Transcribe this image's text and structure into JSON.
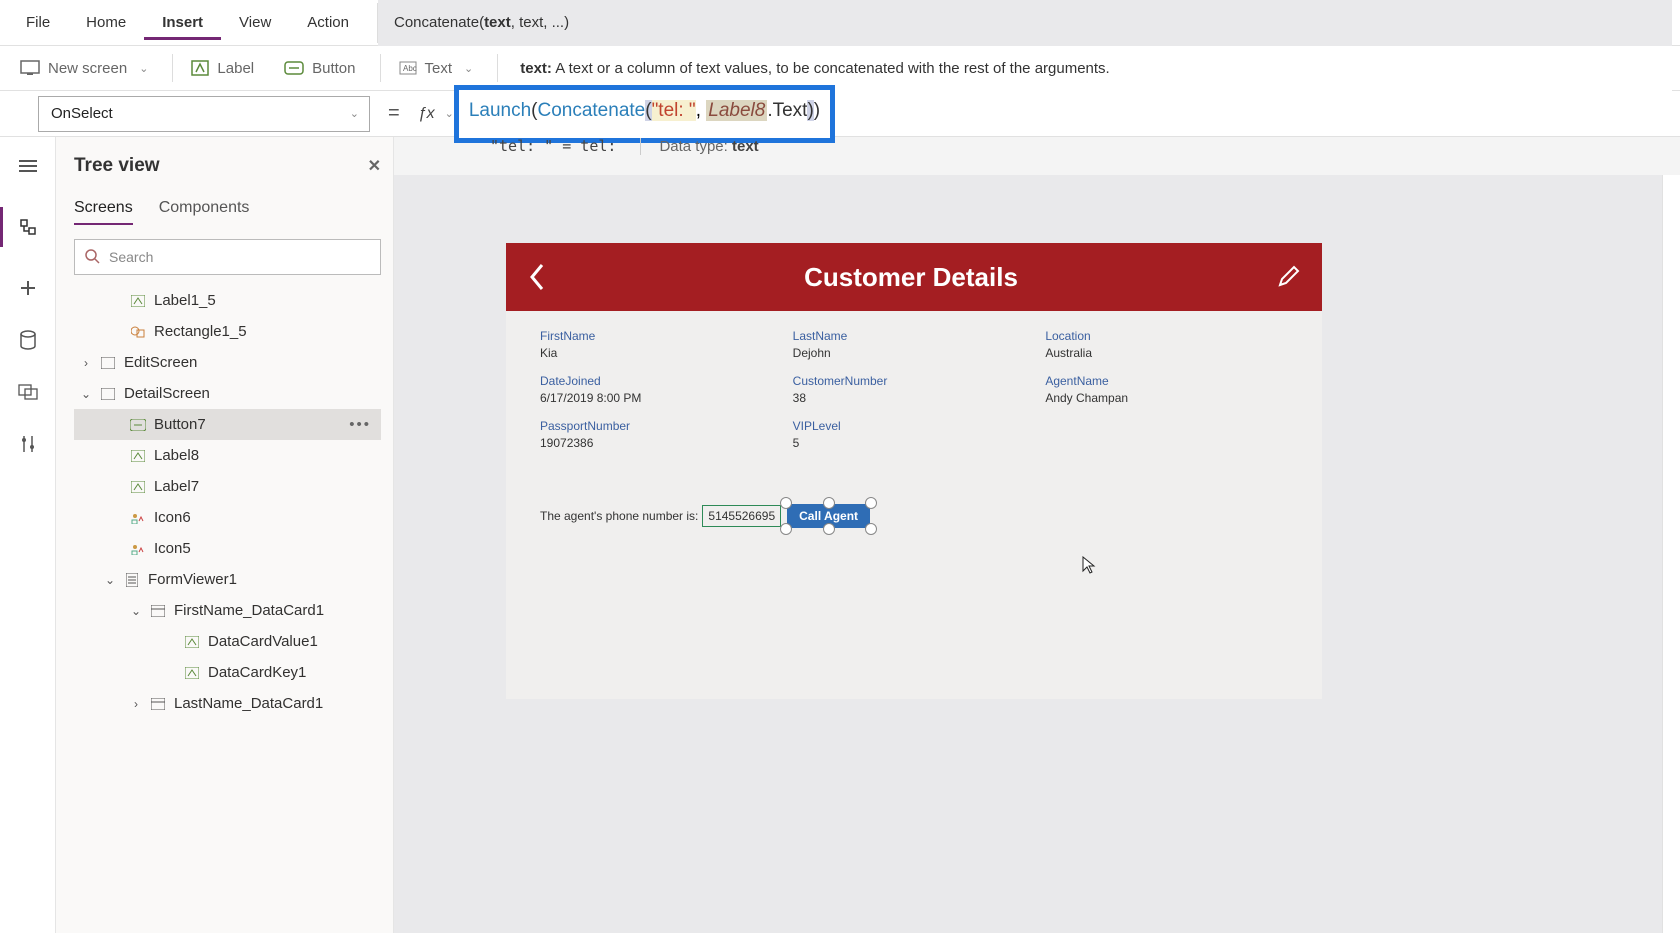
{
  "menu": {
    "file": "File",
    "home": "Home",
    "insert": "Insert",
    "view": "View",
    "action": "Action"
  },
  "hint": "Concatenate(text, text, ...)",
  "ribbon": {
    "newScreen": "New screen",
    "label": "Label",
    "button": "Button",
    "text": "Text"
  },
  "desc": {
    "prefix": "text:",
    "body": " A text or a column of text values, to be concatenated with the rest of the arguments."
  },
  "property": "OnSelect",
  "formula": {
    "launch": "Launch",
    "concat": "Concatenate",
    "str": "\"tel: \"",
    "ref": "Label8",
    "prop": ".Text"
  },
  "result": {
    "left": "\"tel: \"  =  tel:",
    "label": "Data type: ",
    "type": "text"
  },
  "tree": {
    "title": "Tree view",
    "tabs": {
      "screens": "Screens",
      "components": "Components"
    },
    "searchPlaceholder": "Search",
    "items": {
      "label1_5": "Label1_5",
      "rect1_5": "Rectangle1_5",
      "editScreen": "EditScreen",
      "detailScreen": "DetailScreen",
      "button7": "Button7",
      "label8": "Label8",
      "label7": "Label7",
      "icon6": "Icon6",
      "icon5": "Icon5",
      "formViewer1": "FormViewer1",
      "firstNameCard": "FirstName_DataCard1",
      "dataCardValue1": "DataCardValue1",
      "dataCardKey1": "DataCardKey1",
      "lastNameCard": "LastName_DataCard1"
    }
  },
  "app": {
    "title": "Customer Details",
    "fields": {
      "firstName": {
        "label": "FirstName",
        "value": "Kia"
      },
      "lastName": {
        "label": "LastName",
        "value": "Dejohn"
      },
      "location": {
        "label": "Location",
        "value": "Australia"
      },
      "dateJoined": {
        "label": "DateJoined",
        "value": "6/17/2019 8:00 PM"
      },
      "customerNumber": {
        "label": "CustomerNumber",
        "value": "38"
      },
      "agentName": {
        "label": "AgentName",
        "value": "Andy Champan"
      },
      "passport": {
        "label": "PassportNumber",
        "value": "19072386"
      },
      "vip": {
        "label": "VIPLevel",
        "value": "5"
      }
    },
    "agentText": "The agent's phone number is:",
    "phone": "5145526695",
    "callBtn": "Call Agent"
  }
}
